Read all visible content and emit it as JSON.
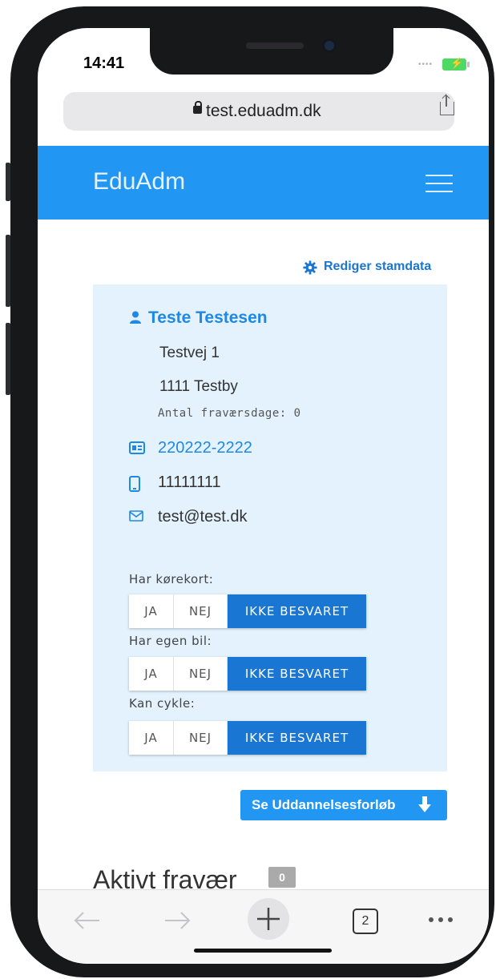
{
  "status": {
    "time": "14:41"
  },
  "browser": {
    "url": "test.eduadm.dk",
    "tab_count": "2"
  },
  "app": {
    "title": "EduAdm"
  },
  "profile": {
    "edit_link": "Rediger stamdata",
    "name": "Teste Testesen",
    "street": "Testvej 1",
    "city": "1111 Testby",
    "absence_days": "Antal fraværsdage: 0",
    "cpr": "220222-2222",
    "phone": "11111111",
    "email": "test@test.dk"
  },
  "questions": [
    {
      "label": "Har kørekort:",
      "options": [
        "JA",
        "NEJ",
        "IKKE BESVARET"
      ],
      "selected": "IKKE BESVARET"
    },
    {
      "label": "Har egen bil:",
      "options": [
        "JA",
        "NEJ",
        "IKKE BESVARET"
      ],
      "selected": "IKKE BESVARET"
    },
    {
      "label": "Kan cykle:",
      "options": [
        "JA",
        "NEJ",
        "IKKE BESVARET"
      ],
      "selected": "IKKE BESVARET"
    }
  ],
  "courses_button": "Se Uddannelsesforløb",
  "absence_section": {
    "title": "Aktivt fravær",
    "count": "0"
  },
  "colors": {
    "primary": "#2196f3",
    "selected": "#1976d2",
    "card": "#e3f2fd"
  }
}
